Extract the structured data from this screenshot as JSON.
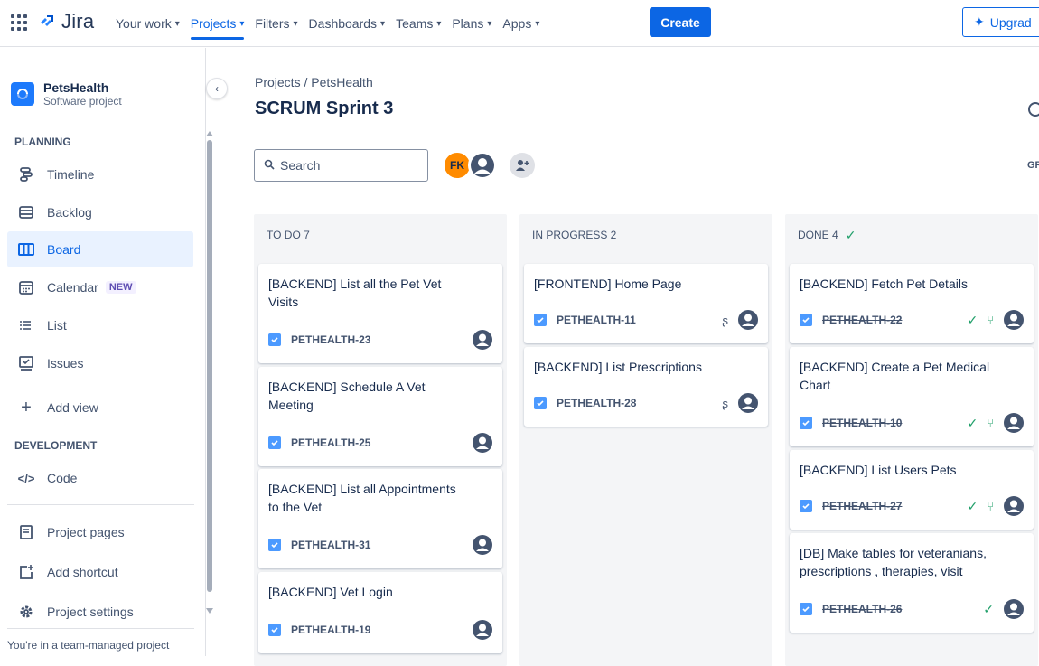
{
  "topbar": {
    "logo": "Jira",
    "nav": [
      {
        "label": "Your work",
        "active": false
      },
      {
        "label": "Projects",
        "active": true
      },
      {
        "label": "Filters",
        "active": false
      },
      {
        "label": "Dashboards",
        "active": false
      },
      {
        "label": "Teams",
        "active": false
      },
      {
        "label": "Plans",
        "active": false
      },
      {
        "label": "Apps",
        "active": false
      }
    ],
    "create": "Create",
    "upgrade": "Upgrad"
  },
  "sidebar": {
    "project_name": "PetsHealth",
    "project_type": "Software project",
    "planning": "PLANNING",
    "items": [
      {
        "label": "Timeline",
        "icon": "timeline-icon"
      },
      {
        "label": "Backlog",
        "icon": "backlog-icon"
      },
      {
        "label": "Board",
        "icon": "board-icon",
        "active": true
      },
      {
        "label": "Calendar",
        "icon": "calendar-icon",
        "badge": "NEW"
      },
      {
        "label": "List",
        "icon": "list-icon"
      },
      {
        "label": "Issues",
        "icon": "issues-icon"
      },
      {
        "label": "Add view",
        "icon": "plus-icon"
      }
    ],
    "development": "DEVELOPMENT",
    "code": "Code",
    "project_pages": "Project pages",
    "add_shortcut": "Add shortcut",
    "project_settings": "Project settings",
    "team_note": "You're in a team-managed project"
  },
  "main": {
    "breadcrumb": "Projects / PetsHealth",
    "title": "SCRUM Sprint 3",
    "search_placeholder": "Search",
    "avatar_initials": "FK",
    "group_label": "GR"
  },
  "columns": [
    {
      "title": "TO DO 7",
      "cards": [
        {
          "title": "[BACKEND] List all the Pet Vet Visits",
          "key": "PETHEALTH-23"
        },
        {
          "title": "[BACKEND] Schedule A Vet Meeting",
          "key": "PETHEALTH-25"
        },
        {
          "title": "[BACKEND] List all Appointments to the Vet",
          "key": "PETHEALTH-31"
        },
        {
          "title": "[BACKEND] Vet Login",
          "key": "PETHEALTH-19"
        }
      ]
    },
    {
      "title": "IN PROGRESS 2",
      "cards": [
        {
          "title": "[FRONTEND] Home Page",
          "key": "PETHEALTH-11"
        },
        {
          "title": "[BACKEND] List Prescriptions",
          "key": "PETHEALTH-28"
        }
      ]
    },
    {
      "title": "DONE 4",
      "cards": [
        {
          "title": "[BACKEND] Fetch Pet Details",
          "key": "PETHEALTH-22"
        },
        {
          "title": "[BACKEND] Create a Pet Medical Chart",
          "key": "PETHEALTH-10"
        },
        {
          "title": "[BACKEND] List Users Pets",
          "key": "PETHEALTH-27"
        },
        {
          "title": "[DB] Make tables for veteranians, prescriptions , therapies, visit",
          "key": "PETHEALTH-26"
        }
      ]
    }
  ],
  "colors": {
    "accent": "#0c66e4",
    "done": "#22a06b",
    "avatar_fk": "#ff8b00"
  }
}
